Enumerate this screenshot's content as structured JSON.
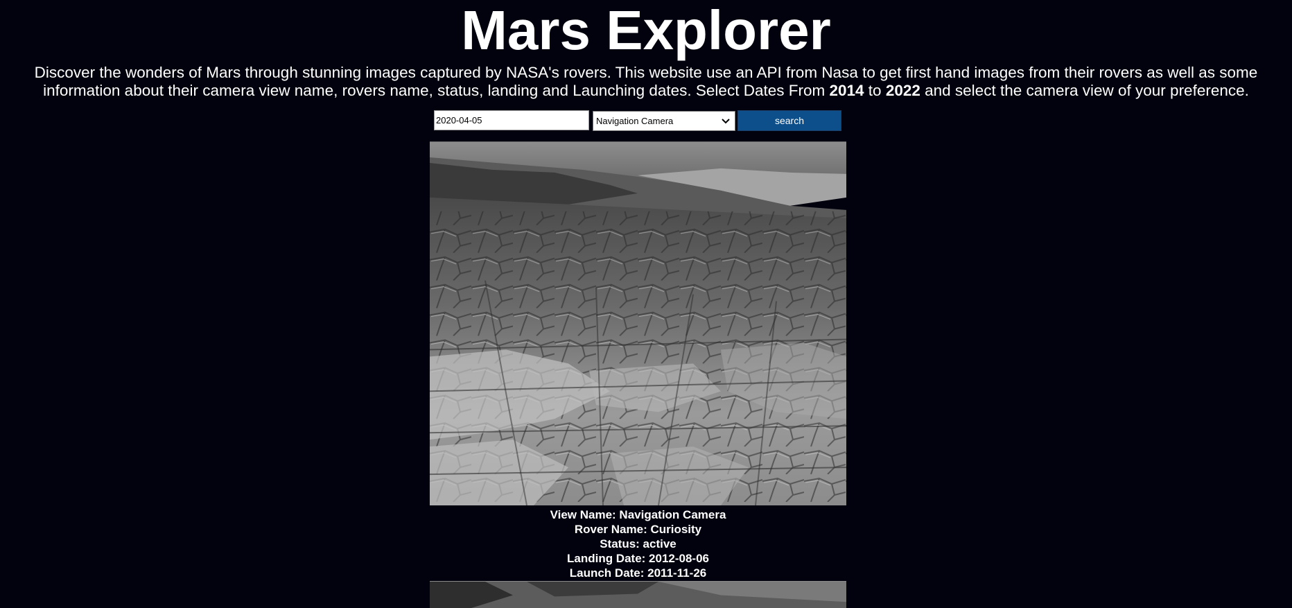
{
  "header": {
    "title": "Mars Explorer"
  },
  "intro": {
    "text_a": "Discover the wonders of Mars through stunning images captured by NASA's rovers. This website use an API from Nasa to get first hand images from their rovers as well as some information about their camera view name, rovers name, status, landing and Launching dates. Select Dates From ",
    "year_from": "2014",
    "text_b": " to ",
    "year_to": "2022",
    "text_c": " and select the camera view of your preference."
  },
  "controls": {
    "date_value": "2020-04-05",
    "camera_selected": "Navigation Camera",
    "camera_icon": "chevron-down-icon",
    "search_label": "search"
  },
  "photos": [
    {
      "view_name": "View Name: Navigation Camera",
      "rover_name": "Rover Name: Curiosity",
      "status": "Status: active",
      "landing_date": "Landing Date: 2012-08-06",
      "launch_date": "Launch Date: 2011-11-26"
    }
  ],
  "colors": {
    "background": "#02020f",
    "button": "#0c4f8b",
    "text": "#ffffff"
  }
}
